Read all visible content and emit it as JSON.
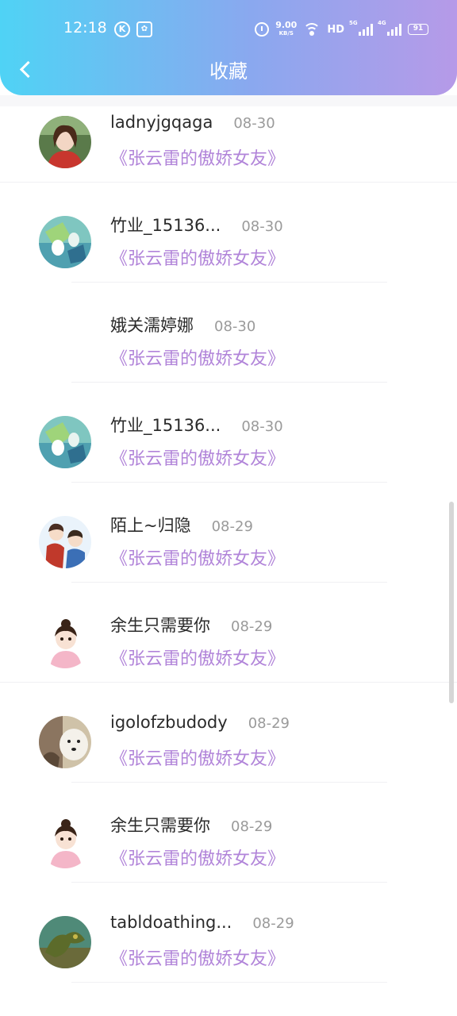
{
  "status_bar": {
    "time": "12:18",
    "speed_value": "9.00",
    "speed_unit": "KB/S",
    "hd": "HD",
    "sig1": "5G",
    "sig2": "4G",
    "battery": "91"
  },
  "header": {
    "title": "收藏"
  },
  "items": [
    {
      "name": "ladnyjgqaga",
      "date": "08-30",
      "book": "《张云雷的傲娇女友》",
      "avatar": "girl-red-sweater"
    },
    {
      "name": "竹业_15136...",
      "date": "08-30",
      "book": "《张云雷的傲娇女友》",
      "avatar": "anime-couple-green"
    },
    {
      "name": "娥关濡婷娜",
      "date": "08-30",
      "book": "《张云雷的傲娇女友》",
      "avatar": "none"
    },
    {
      "name": "竹业_15136...",
      "date": "08-30",
      "book": "《张云雷的傲娇女友》",
      "avatar": "anime-couple-green"
    },
    {
      "name": "陌上~归隐",
      "date": "08-29",
      "book": "《张云雷的傲娇女友》",
      "avatar": "cartoon-boys"
    },
    {
      "name": "余生只需要你",
      "date": "08-29",
      "book": "《张云雷的傲娇女友》",
      "avatar": "cartoon-girl"
    },
    {
      "name": "igolofzbudody",
      "date": "08-29",
      "book": "《张云雷的傲娇女友》",
      "avatar": "dog-photo"
    },
    {
      "name": "余生只需要你",
      "date": "08-29",
      "book": "《张云雷的傲娇女友》",
      "avatar": "cartoon-girl"
    },
    {
      "name": "tabldoathing...",
      "date": "08-29",
      "book": "《张云雷的傲娇女友》",
      "avatar": "dragon-statue"
    }
  ],
  "colors": {
    "header_start": "#4fd3f5",
    "header_end": "#b69ae8",
    "book_title": "#b184d9"
  }
}
